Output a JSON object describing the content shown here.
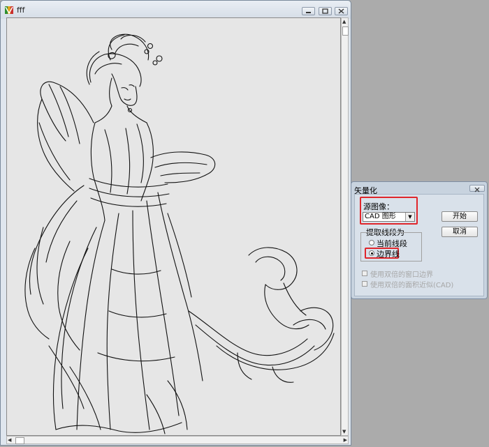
{
  "main_window": {
    "title": "fff",
    "buttons": {
      "minimize": "minimize-icon",
      "maximize": "maximize-icon",
      "close": "close-icon"
    }
  },
  "drawing": {
    "subject": "vector line drawing of a dancing woman in flowing robes"
  },
  "vectorize_dialog": {
    "title": "矢量化",
    "source_image_label": "源图像：",
    "source_image_value": "CAD 图形",
    "extract_group_label": "提取线段为",
    "radio_options": [
      {
        "label": "当前线段",
        "selected": false
      },
      {
        "label": "边界线",
        "selected": true
      }
    ],
    "checkboxes": [
      {
        "label": "使用双倍的窗口边界",
        "enabled": false
      },
      {
        "label": "使用双倍的面积近似(CAD)",
        "enabled": false
      }
    ],
    "start_button": "开始",
    "cancel_button": "取消"
  },
  "colors": {
    "highlight": "#e0262b",
    "dialog_bg": "#d9e1ea",
    "canvas_bg": "#e6e6e6"
  }
}
